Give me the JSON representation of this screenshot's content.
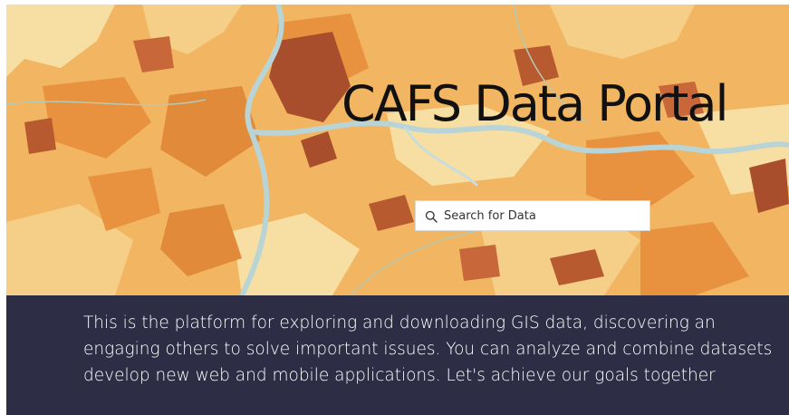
{
  "hero": {
    "title": "CAFS Data Portal",
    "background": "orange-land-cover-map"
  },
  "search": {
    "placeholder": "Search for Data",
    "icon": "search-icon"
  },
  "intro": {
    "lines": [
      "This is the platform for exploring and downloading GIS data, discovering an",
      "engaging others to solve important issues. You can analyze and combine datasets",
      "develop new web and mobile applications. Let's achieve our goals together"
    ]
  },
  "colors": {
    "map_base": "#f2b562",
    "map_dark": "#c8683a",
    "map_light": "#f7dfa4",
    "river": "#b9d4d6",
    "intro_bg": "#2d2d45",
    "intro_text": "#ffffff",
    "title_text": "#111111"
  }
}
